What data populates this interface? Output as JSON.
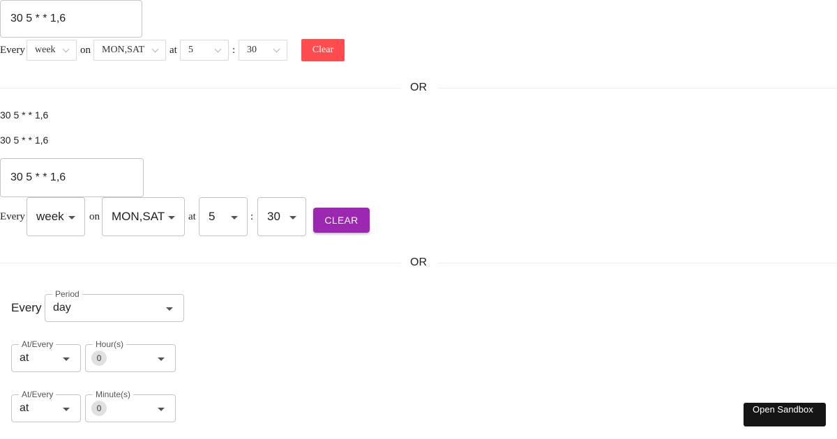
{
  "section1": {
    "cron_value": "30 5 * * 1,6",
    "every_label": "Every",
    "period_value": "week",
    "on_label": "on",
    "weekdays_value": "MON,SAT",
    "at_label": "at",
    "hour_value": "5",
    "colon": ":",
    "minute_value": "30",
    "clear_label": "Clear",
    "clear_color": "#ff4d4f"
  },
  "divider1": {
    "label": "OR"
  },
  "section2": {
    "line1": "30 5 * * 1,6",
    "line2": "30 5 * * 1,6"
  },
  "section3": {
    "cron_value": "30 5 * * 1,6",
    "every_label": "Every",
    "period_value": "week",
    "on_label": "on",
    "weekdays_value": "MON,SAT",
    "at_label": "at",
    "hour_value": "5",
    "colon": ":",
    "minute_value": "30",
    "clear_label": "CLEAR",
    "clear_color": "#9c27b0"
  },
  "divider2": {
    "label": "OR"
  },
  "section4": {
    "every_label": "Every",
    "period": {
      "label": "Period",
      "value": "day"
    },
    "hours_row": {
      "mode_label": "At/Every",
      "mode_value": "at",
      "field_label": "Hour(s)",
      "chip": "0"
    },
    "minutes_row": {
      "mode_label": "At/Every",
      "mode_value": "at",
      "field_label": "Minute(s)",
      "chip": "0"
    }
  },
  "sandbox_button": {
    "label": "Open Sandbox"
  },
  "icons": [
    "chevron-down-icon",
    "dropdown-arrow-icon"
  ]
}
